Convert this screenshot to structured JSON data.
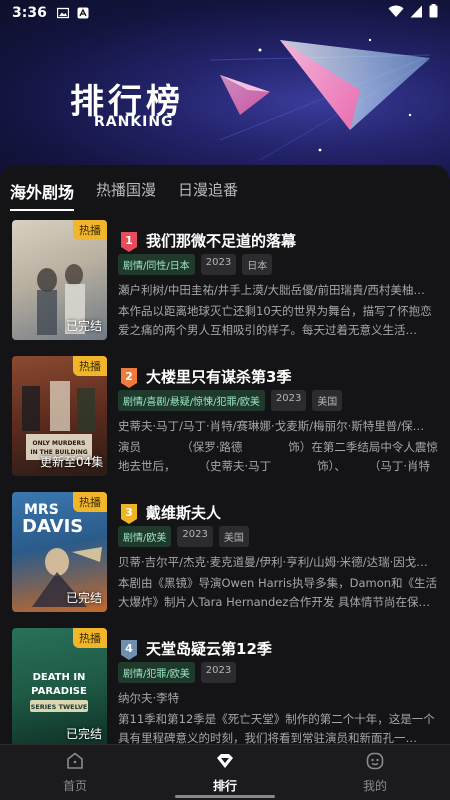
{
  "status_bar": {
    "time": "3:36"
  },
  "header": {
    "title": "排行榜",
    "subtitle": "RANKING"
  },
  "tabs": [
    {
      "label": "海外剧场",
      "active": true
    },
    {
      "label": "热播国漫",
      "active": false
    },
    {
      "label": "日漫追番",
      "active": false
    }
  ],
  "items": [
    {
      "rank": "1",
      "title": "我们那微不足道的落幕",
      "hot_badge": "热播",
      "status": "已完结",
      "tags": [
        "剧情/同性/日本",
        "2023",
        "日本"
      ],
      "cast": "瀬户利树/中田圭祐/井手上漠/大朏岳優/前田瑞貴/西村美柚…",
      "desc": "本作品以距离地球灭亡还剩10天的世界为舞台，描写了怀抱恋爱之痛的两个男人互相吸引的样子。每天过着无意义生活…",
      "rank_color": "#e84c5a",
      "poster_colors": [
        "#c9c2b3",
        "#7f8a95"
      ]
    },
    {
      "rank": "2",
      "title": "大楼里只有谋杀第3季",
      "hot_badge": "热播",
      "status": "更新至04集",
      "tags": [
        "剧情/喜剧/悬疑/惊悚/犯罪/欧美",
        "2023",
        "美国"
      ],
      "cast": "史蒂夫·马丁/马丁·肖特/赛琳娜·戈麦斯/梅丽尔·斯特里普/保…",
      "desc": "演员　　　　（保罗·路德　　　　饰）在第二季结局中令人震惊地去世后，　　　（史蒂夫·马丁　　　　饰）、　　　（马丁·肖特",
      "rank_color": "#f07a3c",
      "poster_colors": [
        "#7a3b2a",
        "#2a1c18"
      ]
    },
    {
      "rank": "3",
      "title": "戴维斯夫人",
      "hot_badge": "热播",
      "status": "已完结",
      "tags": [
        "剧情/欧美",
        "2023",
        "美国"
      ],
      "cast": "贝蒂·吉尔平/杰克·麦克道曼/伊利·亨利/山姆·米德/达瑞·因戈…",
      "desc": "本剧由《黑镜》导演Owen Harris执导多集，Damon和《生活大爆炸》制片人Tara Hernandez合作开发 具体情节尚在保…",
      "rank_color": "#f0b422",
      "poster_colors": [
        "#2b5b8a",
        "#c46a2a"
      ]
    },
    {
      "rank": "4",
      "title": "天堂岛疑云第12季",
      "hot_badge": "热播",
      "status": "已完结",
      "tags": [
        "剧情/犯罪/欧美",
        "2023"
      ],
      "cast": "纳尔夫·李特",
      "desc": "第11季和第12季是《死亡天堂》制作的第二个十年，这是一个具有里程碑意义的时刻，我们将看到常驻演员和新面孔一…",
      "rank_color": "#6f8fb0",
      "poster_colors": [
        "#1e5a45",
        "#0f2f25"
      ]
    }
  ],
  "bottom_nav": [
    {
      "label": "首页",
      "icon": "home-icon",
      "active": false
    },
    {
      "label": "排行",
      "icon": "ranking-icon",
      "active": true
    },
    {
      "label": "我的",
      "icon": "profile-icon",
      "active": false
    }
  ]
}
